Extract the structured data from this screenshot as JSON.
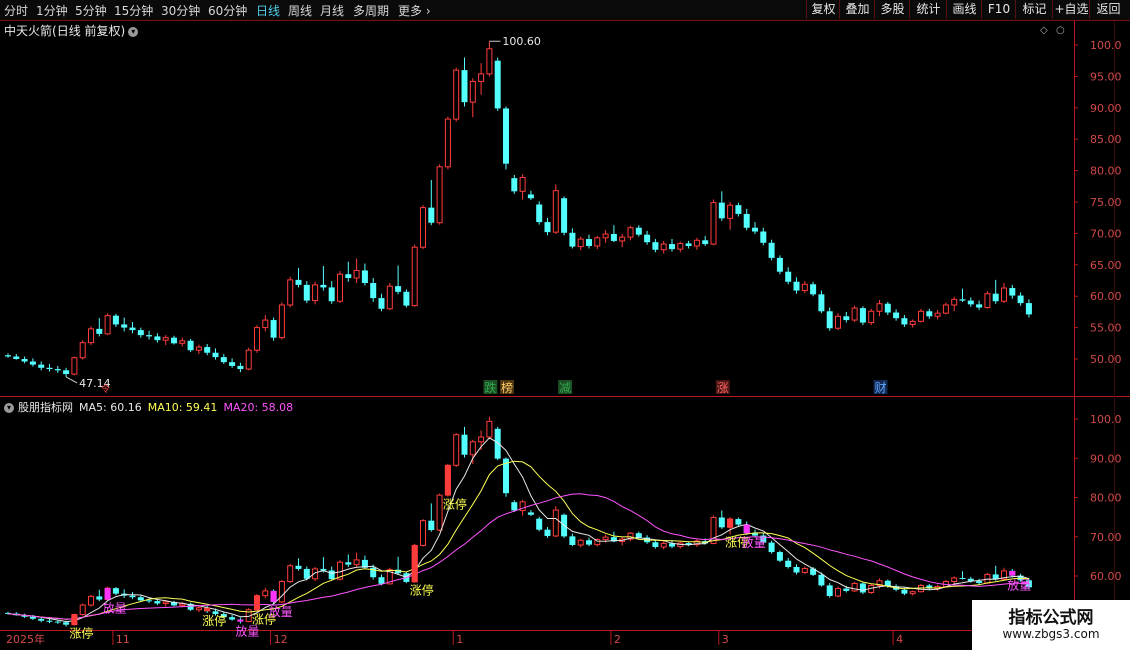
{
  "toolbar": {
    "timeframes": [
      {
        "label": "分时",
        "active": false
      },
      {
        "label": "1分钟",
        "active": false
      },
      {
        "label": "5分钟",
        "active": false
      },
      {
        "label": "15分钟",
        "active": false
      },
      {
        "label": "30分钟",
        "active": false
      },
      {
        "label": "60分钟",
        "active": false
      },
      {
        "label": "日线",
        "active": true
      },
      {
        "label": "周线",
        "active": false
      },
      {
        "label": "月线",
        "active": false
      },
      {
        "label": "多周期",
        "active": false
      },
      {
        "label": "更多",
        "active": false
      }
    ],
    "right_buttons": [
      "复权",
      "叠加",
      "多股",
      "统计",
      "画线",
      "F10",
      "标记",
      "+自选",
      "返回"
    ]
  },
  "main_chart": {
    "stock_name": "中天火箭",
    "period_info": "(日线 前复权)",
    "high_label": "100.60",
    "low_label": "47.14",
    "y_ticks": [
      "100.0",
      "95.00",
      "90.00",
      "85.00",
      "80.00",
      "75.00",
      "70.00",
      "65.00",
      "60.00",
      "55.00",
      "50.00"
    ],
    "markers": [
      {
        "text": "跌",
        "color": "#2fa84f",
        "bg": "#1d4d22",
        "index": 58
      },
      {
        "text": "榜",
        "color": "#ffcc66",
        "bg": "#4d3510",
        "index": 60
      },
      {
        "text": "减",
        "color": "#2fa84f",
        "bg": "#1d4d22",
        "index": 67
      },
      {
        "text": "涨",
        "color": "#ff6666",
        "bg": "#4d1515",
        "index": 86
      },
      {
        "text": "财",
        "color": "#5fa8ff",
        "bg": "#142a55",
        "index": 105
      }
    ]
  },
  "indicator_panel": {
    "name": "股朋指标网",
    "ma5": {
      "label": "MA5: 60.16",
      "color": "#e8e8e8"
    },
    "ma10": {
      "label": "MA10: 59.41",
      "color": "#ffff55"
    },
    "ma20": {
      "label": "MA20: 58.08",
      "color": "#ff55ff"
    },
    "y_ticks": [
      "100.0",
      "90.00",
      "80.00",
      "70.00",
      "60.00"
    ],
    "signal_labels": [
      {
        "text": "涨停",
        "index": 8,
        "color": "#ffff55"
      },
      {
        "text": "涨停",
        "index": 24,
        "color": "#ffff55"
      },
      {
        "text": "涨停",
        "index": 30,
        "color": "#ffff55"
      },
      {
        "text": "涨停",
        "index": 49,
        "color": "#ffff55"
      },
      {
        "text": "涨停",
        "index": 53,
        "color": "#ffff55"
      },
      {
        "text": "涨停",
        "index": 87,
        "color": "#ffff55"
      },
      {
        "text": "放量",
        "index": 12,
        "color": "#ff55ff"
      },
      {
        "text": "放量",
        "index": 28,
        "color": "#ff55ff"
      },
      {
        "text": "放量",
        "index": 32,
        "color": "#ff55ff"
      },
      {
        "text": "放量",
        "index": 89,
        "color": "#ff55ff"
      },
      {
        "text": "放量",
        "index": 121,
        "color": "#ff55ff"
      }
    ]
  },
  "date_axis": [
    {
      "label": "2025年",
      "index": 0
    },
    {
      "label": "11",
      "index": 13
    },
    {
      "label": "12",
      "index": 32
    },
    {
      "label": "1",
      "index": 54
    },
    {
      "label": "2",
      "index": 73
    },
    {
      "label": "3",
      "index": 86
    },
    {
      "label": "4",
      "index": 107
    }
  ],
  "colors": {
    "up": "#ff3c3c",
    "down": "#54ffff",
    "axis": "#b8191f",
    "bg": "#000000"
  },
  "chart_data": {
    "type": "candlestick",
    "ohlc": [
      [
        50.6,
        50.9,
        50.2,
        50.4
      ],
      [
        50.4,
        50.8,
        49.9,
        50.0
      ],
      [
        50.0,
        50.4,
        49.3,
        49.6
      ],
      [
        49.6,
        50.1,
        48.8,
        49.1
      ],
      [
        49.1,
        49.6,
        48.2,
        48.6
      ],
      [
        48.6,
        49.2,
        48.0,
        48.4
      ],
      [
        48.4,
        48.9,
        47.8,
        48.2
      ],
      [
        48.2,
        48.6,
        47.14,
        47.6
      ],
      [
        47.6,
        50.4,
        47.4,
        50.2
      ],
      [
        50.2,
        53.0,
        49.9,
        52.6
      ],
      [
        52.6,
        55.2,
        52.2,
        54.8
      ],
      [
        54.8,
        56.5,
        53.6,
        54.0
      ],
      [
        54.0,
        57.3,
        53.8,
        56.9
      ],
      [
        56.9,
        57.2,
        55.1,
        55.5
      ],
      [
        55.5,
        56.6,
        54.4,
        55.0
      ],
      [
        55.0,
        55.9,
        54.1,
        54.6
      ],
      [
        54.6,
        55.0,
        53.4,
        53.8
      ],
      [
        53.8,
        54.5,
        53.1,
        53.6
      ],
      [
        53.6,
        54.1,
        52.6,
        53.0
      ],
      [
        53.0,
        53.8,
        52.2,
        53.4
      ],
      [
        53.4,
        53.7,
        52.3,
        52.5
      ],
      [
        52.5,
        53.4,
        52.0,
        52.9
      ],
      [
        52.9,
        53.2,
        51.1,
        51.4
      ],
      [
        51.4,
        52.3,
        50.8,
        51.9
      ],
      [
        51.9,
        52.4,
        50.6,
        51.0
      ],
      [
        51.0,
        51.7,
        49.9,
        50.3
      ],
      [
        50.3,
        50.8,
        49.2,
        49.5
      ],
      [
        49.5,
        50.1,
        48.6,
        48.9
      ],
      [
        48.9,
        49.4,
        47.9,
        48.4
      ],
      [
        48.4,
        51.8,
        48.2,
        51.4
      ],
      [
        51.4,
        55.4,
        51.0,
        55.0
      ],
      [
        55.0,
        57.0,
        54.4,
        56.2
      ],
      [
        56.2,
        56.6,
        52.9,
        53.4
      ],
      [
        53.4,
        59.0,
        53.1,
        58.6
      ],
      [
        58.6,
        63.1,
        58.2,
        62.6
      ],
      [
        62.6,
        64.5,
        61.4,
        61.8
      ],
      [
        61.8,
        62.4,
        58.9,
        59.3
      ],
      [
        59.3,
        62.3,
        58.7,
        61.8
      ],
      [
        61.8,
        64.8,
        60.9,
        61.4
      ],
      [
        61.4,
        62.4,
        58.8,
        59.2
      ],
      [
        59.2,
        64.0,
        58.9,
        63.5
      ],
      [
        63.5,
        65.5,
        62.3,
        62.9
      ],
      [
        62.9,
        66.0,
        62.1,
        64.1
      ],
      [
        64.1,
        65.2,
        61.7,
        62.1
      ],
      [
        62.1,
        62.9,
        59.1,
        59.7
      ],
      [
        59.7,
        60.4,
        57.6,
        58.0
      ],
      [
        58.0,
        62.1,
        57.8,
        61.6
      ],
      [
        61.6,
        64.9,
        60.3,
        60.7
      ],
      [
        60.7,
        61.1,
        58.2,
        58.5
      ],
      [
        58.5,
        68.2,
        58.3,
        67.8
      ],
      [
        67.8,
        74.5,
        67.5,
        74.1
      ],
      [
        74.1,
        78.5,
        71.3,
        71.7
      ],
      [
        71.7,
        81.0,
        71.4,
        80.6
      ],
      [
        80.6,
        88.6,
        80.2,
        88.2
      ],
      [
        88.2,
        96.4,
        87.8,
        96.0
      ],
      [
        96.0,
        98.0,
        90.2,
        90.9
      ],
      [
        90.9,
        94.7,
        88.5,
        94.2
      ],
      [
        94.2,
        97.1,
        92.1,
        95.4
      ],
      [
        95.4,
        100.6,
        95.0,
        99.4
      ],
      [
        97.5,
        98.0,
        89.5,
        89.9
      ],
      [
        89.9,
        90.2,
        80.2,
        81.1
      ],
      [
        78.8,
        79.3,
        76.3,
        76.7
      ],
      [
        76.7,
        79.4,
        75.4,
        78.9
      ],
      [
        76.2,
        76.8,
        75.3,
        75.6
      ],
      [
        74.6,
        75.1,
        71.4,
        71.8
      ],
      [
        71.8,
        72.5,
        69.7,
        70.2
      ],
      [
        70.2,
        77.8,
        69.9,
        76.8
      ],
      [
        75.6,
        75.9,
        69.7,
        70.1
      ],
      [
        70.1,
        70.8,
        67.6,
        67.9
      ],
      [
        67.9,
        69.5,
        67.3,
        69.1
      ],
      [
        69.1,
        69.8,
        67.6,
        68.0
      ],
      [
        68.0,
        69.6,
        67.5,
        69.3
      ],
      [
        69.3,
        70.5,
        68.5,
        69.9
      ],
      [
        69.9,
        71.3,
        68.6,
        68.8
      ],
      [
        68.8,
        69.9,
        67.8,
        69.4
      ],
      [
        69.4,
        71.2,
        68.9,
        70.9
      ],
      [
        70.9,
        71.3,
        69.5,
        69.8
      ],
      [
        69.8,
        70.4,
        68.2,
        68.6
      ],
      [
        68.6,
        69.1,
        67.0,
        67.4
      ],
      [
        67.4,
        68.8,
        66.8,
        68.3
      ],
      [
        68.3,
        69.1,
        67.1,
        67.5
      ],
      [
        67.5,
        68.7,
        67.0,
        68.4
      ],
      [
        68.4,
        68.8,
        67.6,
        68.0
      ],
      [
        68.0,
        69.3,
        67.4,
        68.9
      ],
      [
        68.9,
        69.6,
        68.0,
        68.3
      ],
      [
        68.3,
        75.4,
        68.1,
        74.9
      ],
      [
        74.9,
        76.7,
        72.0,
        72.4
      ],
      [
        72.4,
        75.0,
        70.6,
        74.5
      ],
      [
        74.5,
        74.9,
        72.7,
        73.1
      ],
      [
        73.1,
        73.9,
        70.5,
        70.9
      ],
      [
        70.9,
        71.8,
        69.9,
        70.3
      ],
      [
        70.3,
        70.9,
        68.1,
        68.5
      ],
      [
        68.5,
        69.0,
        65.7,
        66.1
      ],
      [
        66.1,
        66.5,
        63.5,
        63.9
      ],
      [
        63.9,
        64.6,
        61.9,
        62.3
      ],
      [
        62.3,
        63.0,
        60.4,
        60.9
      ],
      [
        60.9,
        62.4,
        60.5,
        61.9
      ],
      [
        61.9,
        62.3,
        60.0,
        60.3
      ],
      [
        60.3,
        60.9,
        57.3,
        57.6
      ],
      [
        57.6,
        58.2,
        54.5,
        54.9
      ],
      [
        54.9,
        57.3,
        54.6,
        56.8
      ],
      [
        56.8,
        57.5,
        55.8,
        56.2
      ],
      [
        56.2,
        58.5,
        55.9,
        58.1
      ],
      [
        58.1,
        58.4,
        55.4,
        55.8
      ],
      [
        55.8,
        58.0,
        55.4,
        57.6
      ],
      [
        57.6,
        59.4,
        56.8,
        58.8
      ],
      [
        58.8,
        59.1,
        57.0,
        57.4
      ],
      [
        57.4,
        57.9,
        56.1,
        56.5
      ],
      [
        56.5,
        57.0,
        55.1,
        55.5
      ],
      [
        55.5,
        56.3,
        55.0,
        56.0
      ],
      [
        56.0,
        58.0,
        55.8,
        57.6
      ],
      [
        57.6,
        58.0,
        56.4,
        56.8
      ],
      [
        56.8,
        57.8,
        56.3,
        57.3
      ],
      [
        57.3,
        59.0,
        57.1,
        58.6
      ],
      [
        58.6,
        59.9,
        57.6,
        59.5
      ],
      [
        59.5,
        61.2,
        59.1,
        59.3
      ],
      [
        59.3,
        59.8,
        58.3,
        58.7
      ],
      [
        58.7,
        59.3,
        57.8,
        58.2
      ],
      [
        58.2,
        60.8,
        58.0,
        60.4
      ],
      [
        60.4,
        62.6,
        58.8,
        59.2
      ],
      [
        59.2,
        62.1,
        58.9,
        61.3
      ],
      [
        61.3,
        61.8,
        59.6,
        60.1
      ],
      [
        60.1,
        60.6,
        58.5,
        58.9
      ],
      [
        58.9,
        59.5,
        56.6,
        57.1
      ]
    ]
  }
}
